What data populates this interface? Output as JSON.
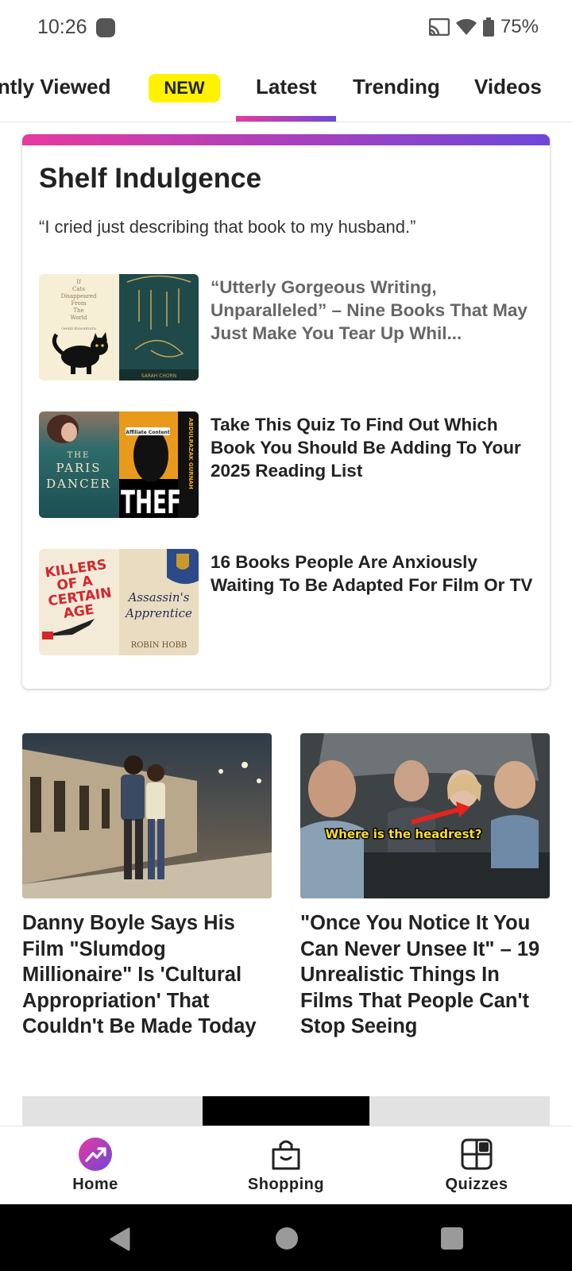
{
  "status_bar": {
    "time": "10:26",
    "battery": "75%"
  },
  "tabs": {
    "recently_viewed": "cently Viewed",
    "new_badge": "NEW",
    "latest": "Latest",
    "trending": "Trending",
    "videos": "Videos"
  },
  "card": {
    "title": "Shelf Indulgence",
    "quote": "“I cried just describing that book to my husband.”",
    "items": [
      {
        "title": "“Utterly Gorgeous Writing, Unparalleled” – Nine Books That May Just Make You Tear Up Whil..."
      },
      {
        "title": "Take This Quiz To Find Out Which Book You Should Be Adding To Your 2025 Reading List"
      },
      {
        "title": "16 Books People Are Anxiously Waiting To Be Adapted For Film Or TV"
      }
    ],
    "covers": {
      "cats": [
        "If",
        "Cats",
        "Disappeared",
        "From",
        "The",
        "World",
        "Genki Kawamura"
      ],
      "nightly_dream_author": "SARAH CHORN",
      "affiliate": "Affiliate Content",
      "paris_dancer": [
        "THE",
        "PARIS",
        "DANCER"
      ],
      "theft": "THEF",
      "theft_side": "ABDULRAZAK GURNAH",
      "killers": [
        "KILLERS",
        "OF A",
        "CERTAIN",
        "AGE"
      ],
      "assassin": [
        "Assassin's",
        "Apprentice"
      ],
      "robin_hobb": "ROBIN HOBB"
    }
  },
  "articles": [
    {
      "title": "Danny Boyle Says His Film \"Slumdog Millionaire\" Is 'Cultural Appropriation' That Couldn't Be Made Today"
    },
    {
      "title": "\"Once You Notice It You Can Never Unsee It\" – 19 Unrealistic Things In Films That People Can't Stop Seeing",
      "image_caption": "Where is the headrest?"
    }
  ],
  "bottom_nav": {
    "home": "Home",
    "shopping": "Shopping",
    "quizzes": "Quizzes"
  },
  "colors": {
    "accent_pink": "#e7399f",
    "accent_purple": "#6d47d9",
    "badge_yellow": "#fff200"
  }
}
